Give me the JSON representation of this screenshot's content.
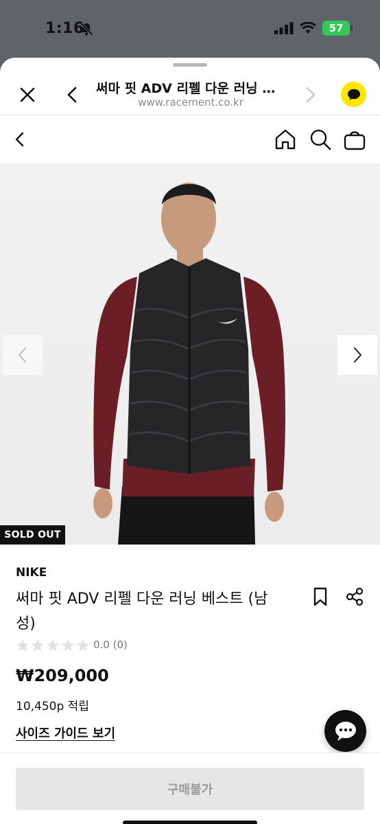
{
  "status_bar": {
    "time": "1:16",
    "battery": "57"
  },
  "browser": {
    "title": "써마 핏 ADV 리펠 다운 러닝 베스트 (남성)",
    "url": "www.racement.co.kr"
  },
  "product": {
    "badge": "SOLD OUT",
    "brand": "NIKE",
    "name": "써마 핏 ADV 리펠 다운 러닝 베스트 (남성)",
    "rating_text": "0.0 (0)",
    "rating_value": 0,
    "price": "₩209,000",
    "points": "10,450p 적립",
    "size_guide": "사이즈 가이드 보기"
  },
  "buy_button": {
    "label": "구매불가"
  },
  "icons": {
    "close": "close-icon",
    "back": "chevron-left-icon",
    "forward": "chevron-right-icon",
    "kakao": "kakao-chat-icon",
    "home": "home-icon",
    "search": "search-icon",
    "cart": "shopping-bag-icon",
    "bookmark": "bookmark-icon",
    "share": "share-icon",
    "chat": "chat-bubble-icon"
  },
  "colors": {
    "kakao": "#fee500",
    "sold_out_bg": "#111111",
    "disabled_btn": "#e6e6e6"
  }
}
